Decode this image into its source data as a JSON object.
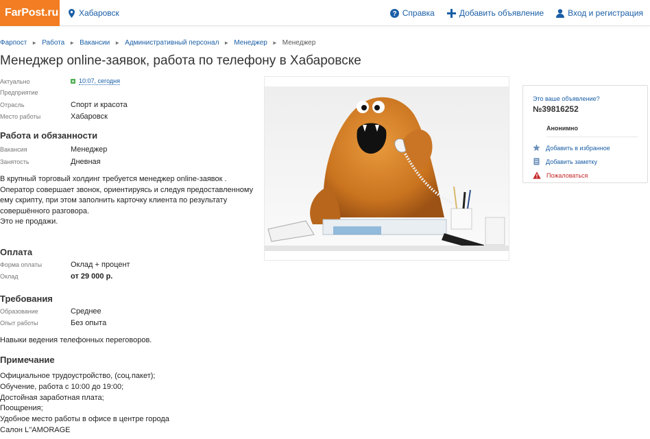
{
  "header": {
    "logo": "FarPost.ru",
    "city": "Хабаровск",
    "nav": {
      "help": "Справка",
      "add": "Добавить объявление",
      "login": "Вход и регистрация"
    }
  },
  "breadcrumb": [
    "Фарпост",
    "Работа",
    "Вакансии",
    "Административный персонал",
    "Менеджер",
    "Менеджер"
  ],
  "title": "Менеджер online-заявок, работа по телефону в Хабаровске",
  "info": {
    "actual_label": "Актуально",
    "actual_value": "10:07, сегодня",
    "company_label": "Предприятие",
    "industry_label": "Отрасль",
    "industry_value": "Спорт и красота",
    "location_label": "Место работы",
    "location_value": "Хабаровск"
  },
  "duties": {
    "title": "Работа и обязанности",
    "vacancy_label": "Вакансия",
    "vacancy_value": "Менеджер",
    "employment_label": "Занятость",
    "employment_value": "Дневная",
    "text": [
      "В крупный торговый холдинг требуется менеджер online-заявок .",
      "Оператор совершает звонок, ориентируясь и следуя предоставленному",
      "ему скрипту, при этом заполнить карточку клиента по результату",
      "совершённого разговора.",
      "Это не продажи."
    ]
  },
  "payment": {
    "title": "Оплата",
    "form_label": "Форма оплаты",
    "form_value": "Оклад + процент",
    "salary_label": "Оклад",
    "salary_value": "от 29 000 р."
  },
  "requirements": {
    "title": "Требования",
    "education_label": "Образование",
    "education_value": "Среднее",
    "experience_label": "Опыт работы",
    "experience_value": "Без опыта",
    "text": "Навыки ведения телефонных переговоров."
  },
  "note": {
    "title": "Примечание",
    "text": [
      "Официальное трудоустройство, (соц.пакет);",
      "Обучение, работа с 10:00 до 19:00;",
      "Достойная заработная плата;",
      "Поощрения;",
      "Удобное место работы в офисе в центре города",
      "Салон L''AMORAGE"
    ]
  },
  "card": {
    "is_yours": "Это ваше объявление?",
    "ad_number": "№39816252",
    "author": "Анонимно",
    "favorite": "Добавить в избранное",
    "note": "Добавить заметку",
    "complain": "Пожаловаться"
  },
  "colors": {
    "brand": "#f27d22",
    "link": "#1a5ea6",
    "complain": "#c62828",
    "fresh": "#4caf50"
  }
}
